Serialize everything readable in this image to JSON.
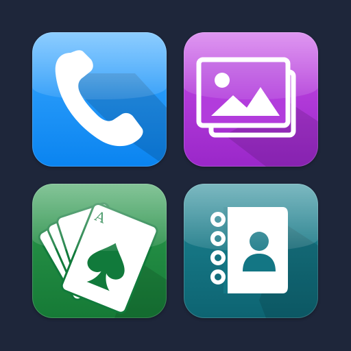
{
  "apps": {
    "phone": {
      "icon": "phone-icon",
      "color": "#1a8ff5"
    },
    "gallery": {
      "icon": "gallery-icon",
      "color": "#b23cdc"
    },
    "cards": {
      "icon": "playing-cards-icon",
      "color": "#1e8a41",
      "card_rank": "A",
      "card_suit": "spade"
    },
    "contacts": {
      "icon": "contacts-book-icon",
      "color": "#137684"
    }
  },
  "background": "#1e263a"
}
